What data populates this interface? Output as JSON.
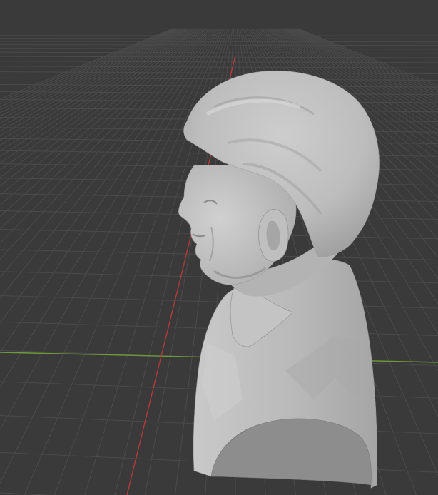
{
  "app": {
    "name": "",
    "view": "3D Viewport"
  },
  "viewport": {
    "background_color": "#3a3a3a",
    "grid_color": "#4b4b4b",
    "x_axis_color": "#6e9b3a",
    "y_axis_color": "#b23a3a",
    "object": {
      "name": "",
      "shading": "solid",
      "color": "#b8b8b8"
    }
  }
}
